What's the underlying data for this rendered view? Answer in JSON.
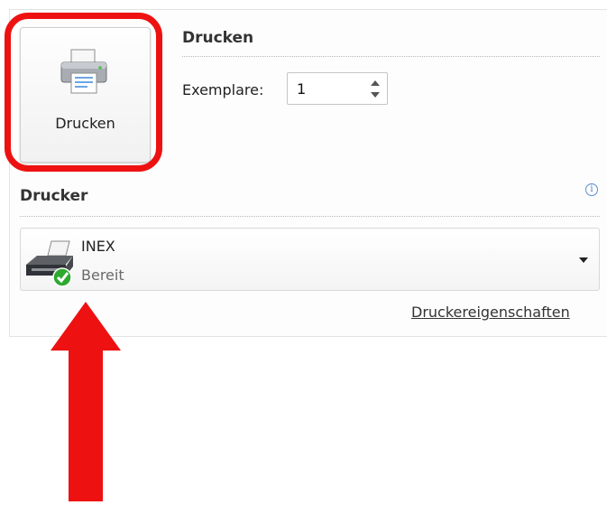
{
  "print_section": {
    "title": "Drucken",
    "button_label": "Drucken",
    "copies_label": "Exemplare:",
    "copies_value": "1"
  },
  "printer_section": {
    "title": "Drucker",
    "printer_name": "INEX",
    "printer_status": "Bereit",
    "properties_link": "Druckereigenschaften"
  },
  "icons": {
    "print_button": "printer-icon",
    "printer": "printer-ready-icon",
    "info": "info-icon",
    "dropdown": "chevron-down-icon"
  },
  "colors": {
    "highlight": "#ee1111",
    "arrow": "#ee1111",
    "ready_check": "#2fa82f",
    "info_accent": "#3f7fcf"
  }
}
